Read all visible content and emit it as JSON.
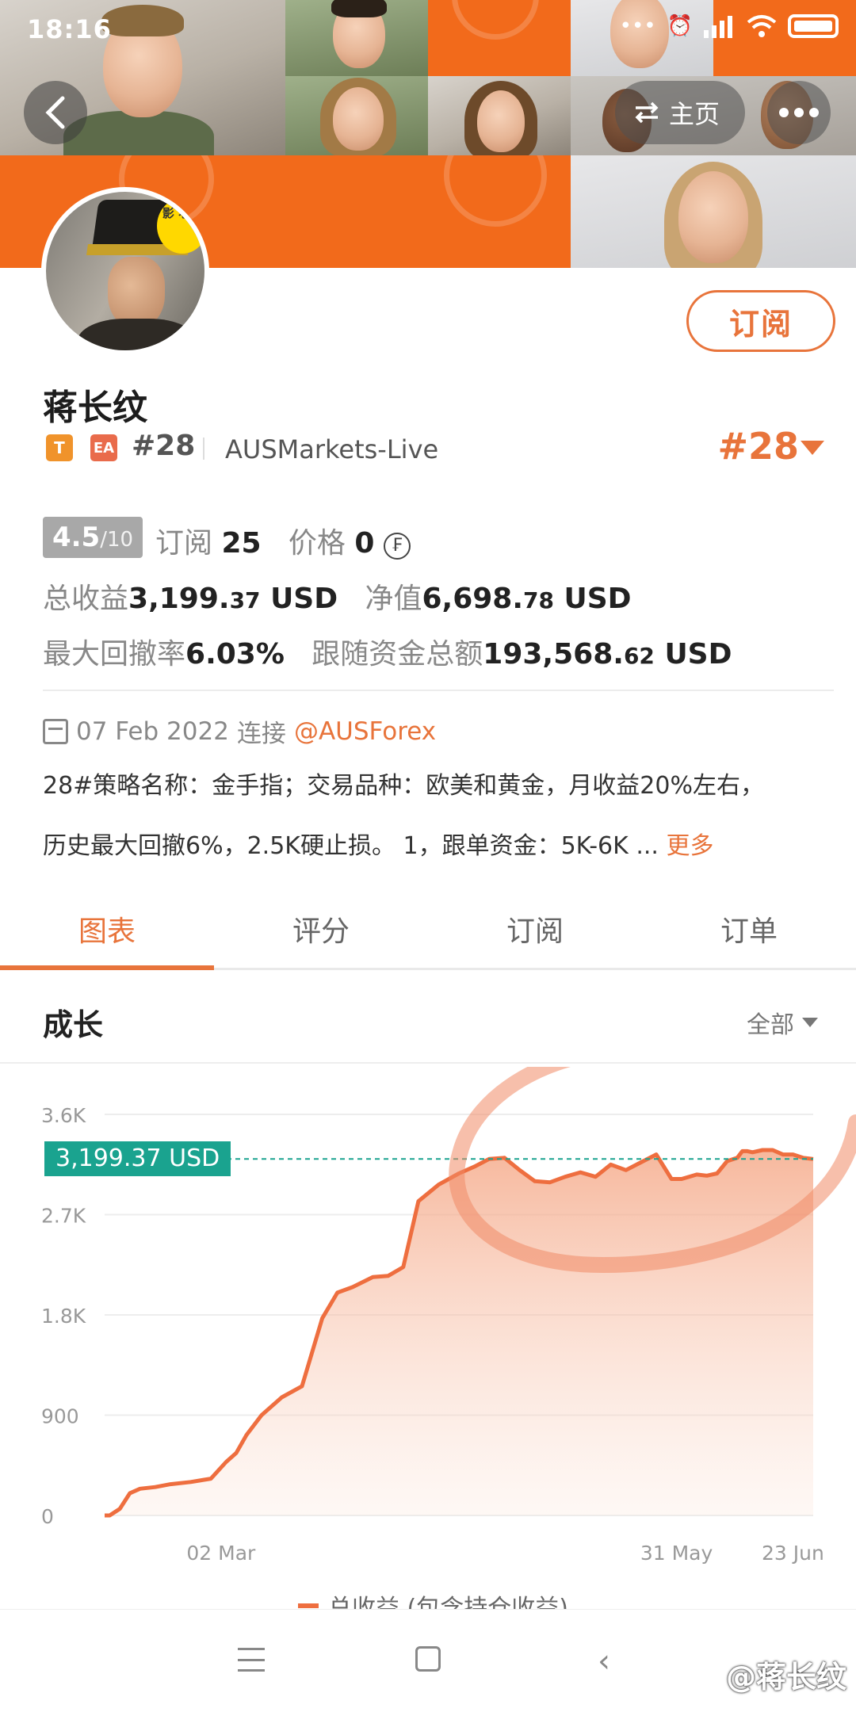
{
  "status_bar": {
    "time": "18:16"
  },
  "banner": {
    "home_label": "主页"
  },
  "avatar": {
    "bubble_text": "影 老欧"
  },
  "profile": {
    "subscribe_label": "订阅",
    "name": "蒋长纹",
    "badge_t": "T",
    "badge_ea": "EA",
    "rank_inline": "#28",
    "server": "AUSMarkets-Live",
    "rank_big": "#28"
  },
  "stats": {
    "score_main": "4.5",
    "score_total": "/10",
    "subscriptions_label": "订阅",
    "subscriptions_value": "25",
    "price_label": "价格",
    "price_value": "0",
    "coin_symbol": "₣",
    "total_profit_label": "总收益",
    "total_profit_int": "3,199.",
    "total_profit_dec": "37",
    "total_profit_unit": " USD",
    "equity_label": "净值",
    "equity_int": "6,698.",
    "equity_dec": "78",
    "equity_unit": " USD",
    "max_drawdown_label": "最大回撤率",
    "max_drawdown_value": "6.03%",
    "follow_funds_label": "跟随资金总额",
    "follow_funds_int": "193,568.",
    "follow_funds_dec": "62",
    "follow_funds_unit": " USD"
  },
  "info": {
    "date": "07 Feb 2022",
    "connect_label": "连接",
    "broker_link": "@AUSForex",
    "desc_line1": "28#策略名称：金手指；交易品种：欧美和黄金，月收益20%左右，",
    "desc_line2": "历史最大回撤6%，2.5K硬止损。 1，跟单资金：5K-6K ...",
    "more_label": "更多"
  },
  "tabs": [
    {
      "label": "图表",
      "active": true
    },
    {
      "label": "评分",
      "active": false
    },
    {
      "label": "订阅",
      "active": false
    },
    {
      "label": "订单",
      "active": false
    }
  ],
  "section": {
    "title": "成长",
    "filter_label": "全部"
  },
  "chart_value_tag": "3,199.37 USD",
  "chart_data": {
    "type": "area",
    "title": "成长",
    "series": [
      {
        "name": "总收益 (包含持仓收益)",
        "color": "#ee6e3f",
        "x": [
          "2022-02-07",
          "2022-02-08",
          "2022-02-10",
          "2022-02-12",
          "2022-02-14",
          "2022-02-17",
          "2022-02-20",
          "2022-02-24",
          "2022-02-28",
          "2022-03-01",
          "2022-03-03",
          "2022-03-05",
          "2022-03-07",
          "2022-03-10",
          "2022-03-14",
          "2022-03-18",
          "2022-03-22",
          "2022-03-25",
          "2022-03-28",
          "2022-04-01",
          "2022-04-04",
          "2022-04-07",
          "2022-04-10",
          "2022-04-14",
          "2022-04-18",
          "2022-04-21",
          "2022-04-24",
          "2022-04-27",
          "2022-04-30",
          "2022-05-03",
          "2022-05-06",
          "2022-05-09",
          "2022-05-12",
          "2022-05-15",
          "2022-05-18",
          "2022-05-21",
          "2022-05-24",
          "2022-05-27",
          "2022-05-30",
          "2022-06-01",
          "2022-06-04",
          "2022-06-06",
          "2022-06-08",
          "2022-06-10",
          "2022-06-12",
          "2022-06-13",
          "2022-06-14",
          "2022-06-15",
          "2022-06-17",
          "2022-06-19",
          "2022-06-21",
          "2022-06-23",
          "2022-06-25",
          "2022-06-27"
        ],
        "y": [
          0,
          0,
          60,
          200,
          240,
          255,
          280,
          300,
          330,
          380,
          480,
          560,
          720,
          900,
          1060,
          1160,
          1770,
          2000,
          2050,
          2140,
          2150,
          2230,
          2820,
          2970,
          3070,
          3130,
          3200,
          3210,
          3100,
          3000,
          2990,
          3040,
          3080,
          3040,
          3150,
          3100,
          3170,
          3240,
          3020,
          3020,
          3060,
          3050,
          3070,
          3180,
          3210,
          3270,
          3270,
          3260,
          3280,
          3280,
          3240,
          3240,
          3210,
          3199.37
        ]
      }
    ],
    "x_ticks": [
      "02 Mar",
      "31 May",
      "23 Jun"
    ],
    "y_ticks": [
      "0",
      "900",
      "1.8K",
      "2.7K",
      "3.6K"
    ],
    "ylim": [
      0,
      3600
    ],
    "grid": true,
    "legend": "bottom"
  },
  "bottom_nav": {
    "back_symbol": "‹",
    "watermark": "@蒋长纹"
  },
  "colors": {
    "accent": "#e8743b",
    "teal": "#1aa38f",
    "banner_orange": "#f26a1b"
  }
}
